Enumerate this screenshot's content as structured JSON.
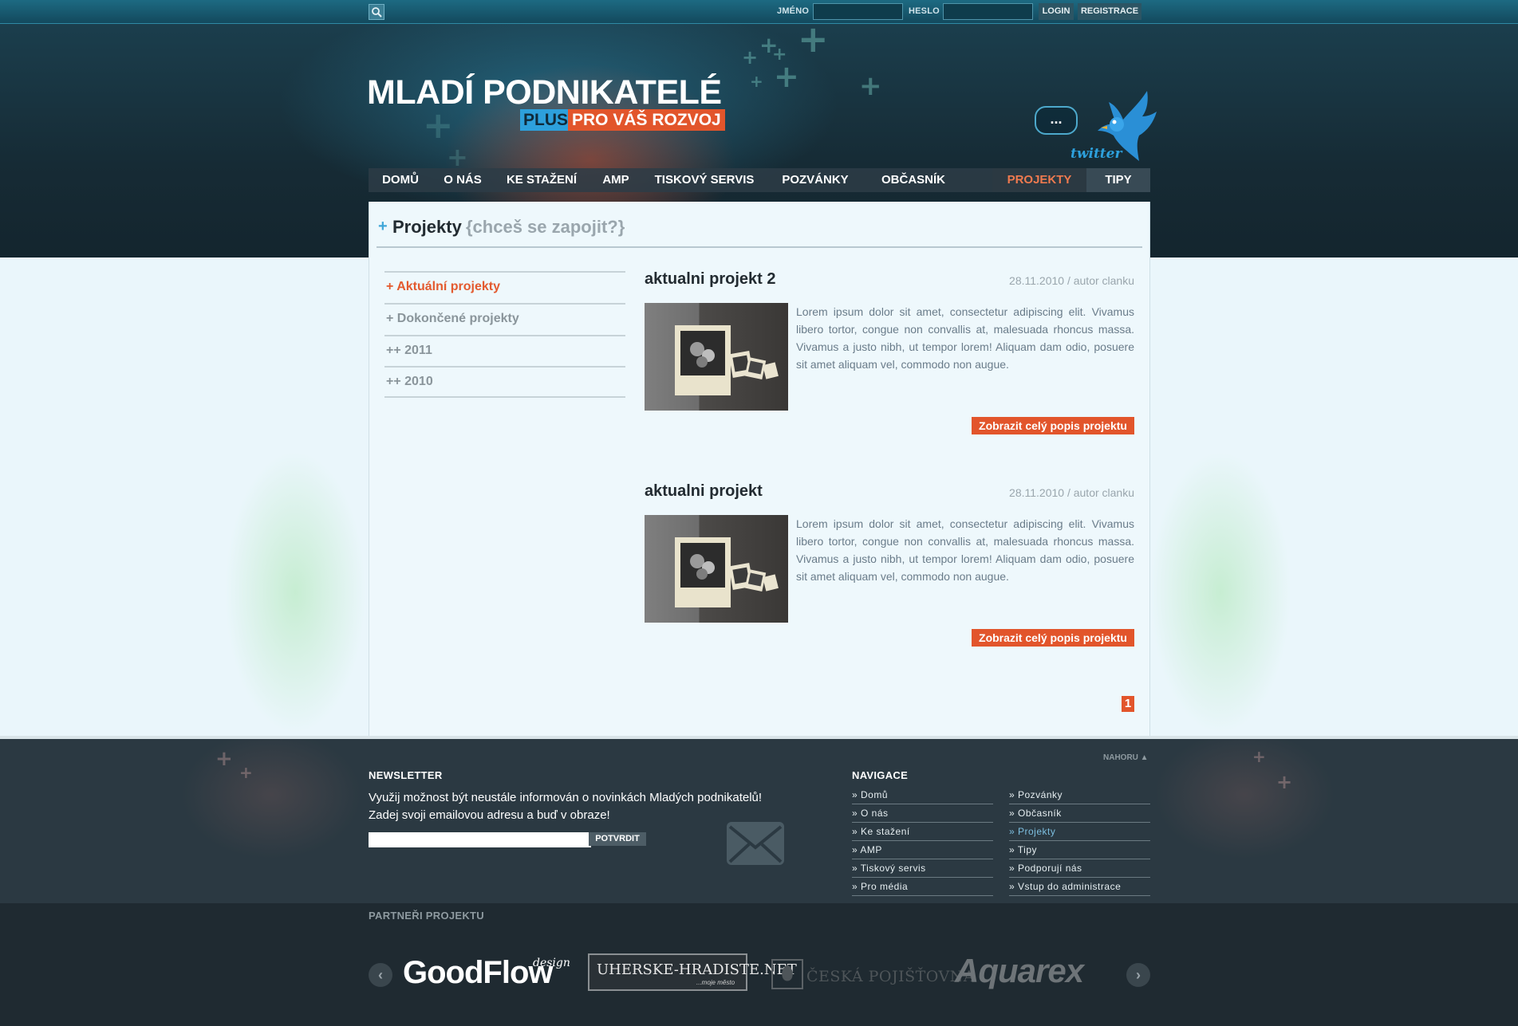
{
  "topbar": {
    "name_label": "JMÉNO",
    "password_label": "HESLO",
    "login_button": "LOGIN",
    "register_button": "REGISTRACE"
  },
  "header": {
    "title": "MLADÍ PODNIKATELÉ",
    "tagline_plus": "PLUS",
    "tagline_rest": "PRO VÁŠ ROZVOJ",
    "bubble_text": "...",
    "twitter_label": "twitter"
  },
  "nav": {
    "items": [
      "DOMŮ",
      "O NÁS",
      "KE STAŽENÍ",
      "AMP",
      "TISKOVÝ SERVIS",
      "POZVÁNKY",
      "OBČASNÍK",
      "PROJEKTY",
      "TIPY"
    ],
    "active": "PROJEKTY"
  },
  "page": {
    "plus": "+",
    "title": "Projekty",
    "subtitle": "{chceš se zapojit?}"
  },
  "sidebar": {
    "items": [
      "+ Aktuální projekty",
      "+ Dokončené projekty",
      "++ 2011",
      "++ 2010"
    ]
  },
  "articles": [
    {
      "title": "aktualni projekt 2",
      "meta": "28.11.2010 / autor clanku",
      "text": "Lorem ipsum dolor sit amet, consectetur adipiscing elit. Vivamus libero tortor, congue non convallis at, malesuada rhoncus massa. Vivamus a justo nibh, ut tempor lorem! Aliquam dam odio, posuere sit amet aliquam vel, commodo non augue.",
      "button": "Zobrazit celý popis projektu"
    },
    {
      "title": "aktualni projekt",
      "meta": "28.11.2010 / autor clanku",
      "text": "Lorem ipsum dolor sit amet, consectetur adipiscing elit. Vivamus libero tortor, congue non convallis at, malesuada rhoncus massa. Vivamus a justo nibh, ut tempor lorem! Aliquam dam odio, posuere sit amet aliquam vel, commodo non augue.",
      "button": "Zobrazit celý popis projektu"
    }
  ],
  "pagination": {
    "current": "1"
  },
  "footer": {
    "back_to_top": "NAHORU",
    "newsletter_heading": "NEWSLETTER",
    "newsletter_text": "Využij možnost být neustále informován o novinkách Mladých podnikatelů! Zadej svoji emailovou adresu a buď v obraze!",
    "newsletter_button": "POTVRDIT",
    "nav_heading": "NAVIGACE",
    "nav_col1": [
      "» Domů",
      "» O nás",
      "» Ke stažení",
      "» AMP",
      "» Tiskový servis",
      "» Pro média"
    ],
    "nav_col2": [
      "» Pozvánky",
      "» Občasník",
      "» Projekty",
      "» Tipy",
      "» Podporují nás",
      "» Vstup do administrace"
    ],
    "nav_active": "» Projekty",
    "partners_heading": "PARTNEŘI PROJEKTU",
    "partners": {
      "goodflow": "GoodFlow",
      "goodflow_suffix": "design",
      "uherske": "UHERSKE-HRADISTE.NET",
      "uherske_sub": "...moje město",
      "ceska": "ČESKÁ POJIŠŤOVNA",
      "aquarex": "Aquarex"
    }
  },
  "colors": {
    "accent": "#e2552b",
    "link_blue": "#2da0dc",
    "page_bg": "#eaf6fb",
    "footer_bg": "#2b3942"
  }
}
